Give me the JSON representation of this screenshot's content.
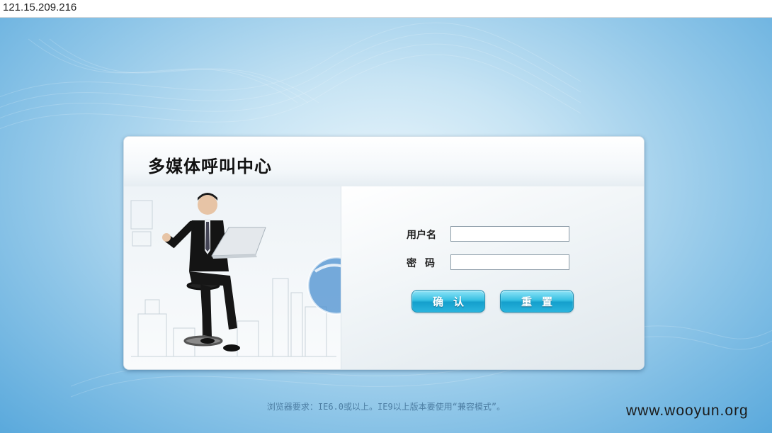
{
  "browser": {
    "address": "121.15.209.216"
  },
  "login": {
    "title": "多媒体呼叫中心",
    "username_label": "用户名",
    "password_label": "密码",
    "username_value": "",
    "password_value": "",
    "confirm_label": "确认",
    "reset_label": "重置"
  },
  "footer": {
    "requirement": "浏览器要求：IE6.0或以上。IE9以上版本要使用“兼容模式”。"
  },
  "watermark": {
    "text": "www.wooyun.org"
  },
  "colors": {
    "button_top": "#8fe4f7",
    "button_bottom": "#149fcc",
    "background_edge": "#5aa9dc"
  }
}
